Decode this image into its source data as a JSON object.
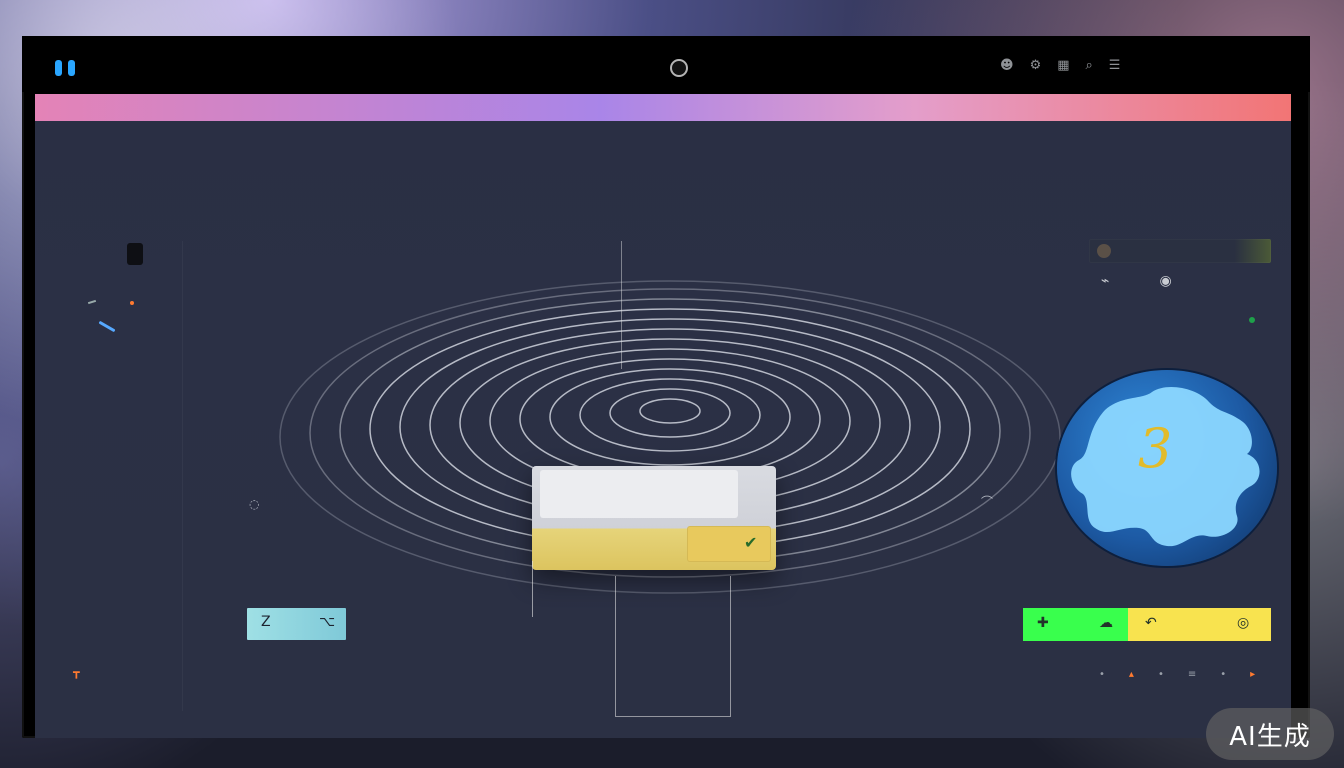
{
  "colors": {
    "accent_blue": "#2aa6ff",
    "strip_start": "#f08ac0",
    "strip_mid": "#b28cf4",
    "strip_end": "#ff7b7b",
    "card_yellow": "#e8c95d",
    "action_green": "#39ff4d",
    "action_yellow": "#f8e34f",
    "badge_blue": "#1d5aa4"
  },
  "topbar": {
    "app_title": "",
    "icons": [
      "profile-icon",
      "settings-icon",
      "grid-icon",
      "search-icon",
      "menu-icon"
    ]
  },
  "screen": {
    "header": {
      "left": "",
      "mid": "",
      "right": ""
    },
    "page_title": "",
    "right_title": "",
    "tabs": [
      "",
      ""
    ],
    "labels": {
      "a": "",
      "b": ""
    },
    "footer": {
      "a": "",
      "b": ""
    },
    "center_card": {
      "title": "",
      "subtitle": ""
    },
    "left_toggle": [
      "Z",
      "⌥"
    ],
    "badge_number": "3"
  },
  "watermark": "AI生成"
}
